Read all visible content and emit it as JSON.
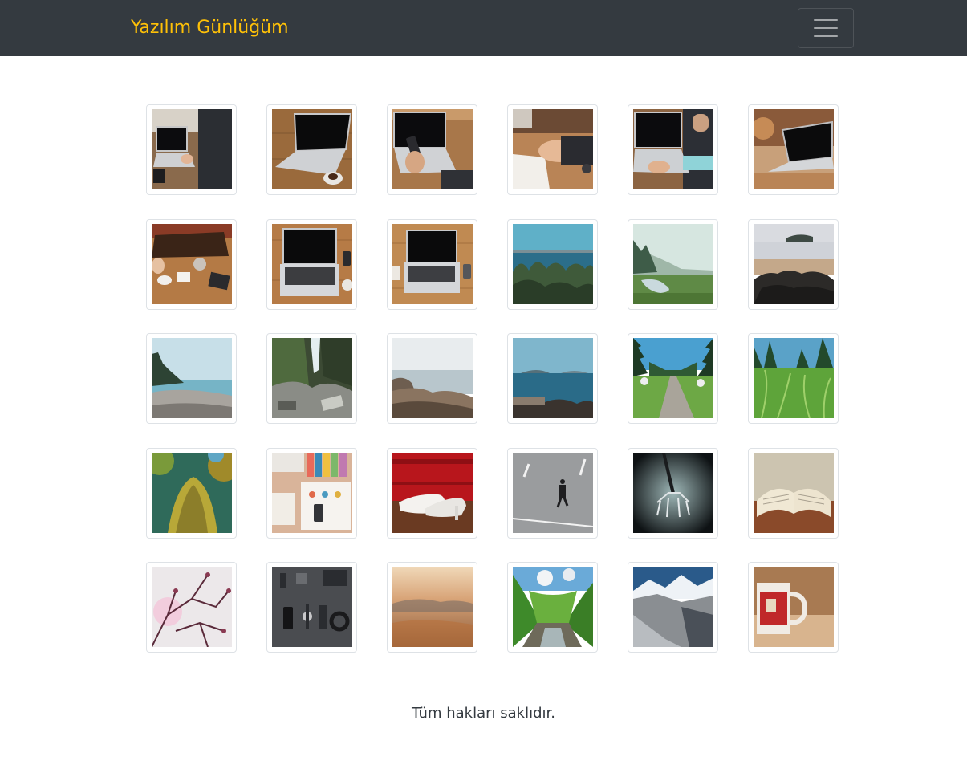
{
  "navbar": {
    "brand": "Yazılım Günlüğüm",
    "brand_color": "#ffc107",
    "background": "#343a40",
    "toggler_icon": "hamburger-menu-icon"
  },
  "gallery": [
    {
      "name": "photo-laptop-typing-man"
    },
    {
      "name": "photo-laptop-coffee-wooden-table"
    },
    {
      "name": "photo-laptop-phone-hands"
    },
    {
      "name": "photo-hands-notebook-writing"
    },
    {
      "name": "photo-man-typing-laptop"
    },
    {
      "name": "photo-laptop-desk-warm-light"
    },
    {
      "name": "photo-table-meeting-leather-bag"
    },
    {
      "name": "photo-laptop-top-view-wood"
    },
    {
      "name": "photo-laptop-top-view-wood-2"
    },
    {
      "name": "photo-sea-horizon-bushes"
    },
    {
      "name": "photo-foggy-valley-river"
    },
    {
      "name": "photo-beach-dark-rocks"
    },
    {
      "name": "photo-pebble-beach-coast"
    },
    {
      "name": "photo-waterfall-rocks"
    },
    {
      "name": "photo-rocky-shore-calm-sea"
    },
    {
      "name": "photo-sea-rocks-island"
    },
    {
      "name": "photo-forest-path"
    },
    {
      "name": "photo-grass-pine-trees"
    },
    {
      "name": "photo-mossy-tree-trunk"
    },
    {
      "name": "photo-desk-flatlay-stationery"
    },
    {
      "name": "photo-white-heels-red-wall"
    },
    {
      "name": "photo-person-walking-road"
    },
    {
      "name": "photo-fork-dark"
    },
    {
      "name": "photo-open-book"
    },
    {
      "name": "photo-pink-blossom-branches"
    },
    {
      "name": "photo-gadgets-flatlay"
    },
    {
      "name": "photo-aerial-clouds-sunset"
    },
    {
      "name": "photo-green-valley-stream"
    },
    {
      "name": "photo-snowy-mountains"
    },
    {
      "name": "photo-red-mug"
    }
  ],
  "footer": {
    "text": "Tüm hakları saklıdır."
  }
}
